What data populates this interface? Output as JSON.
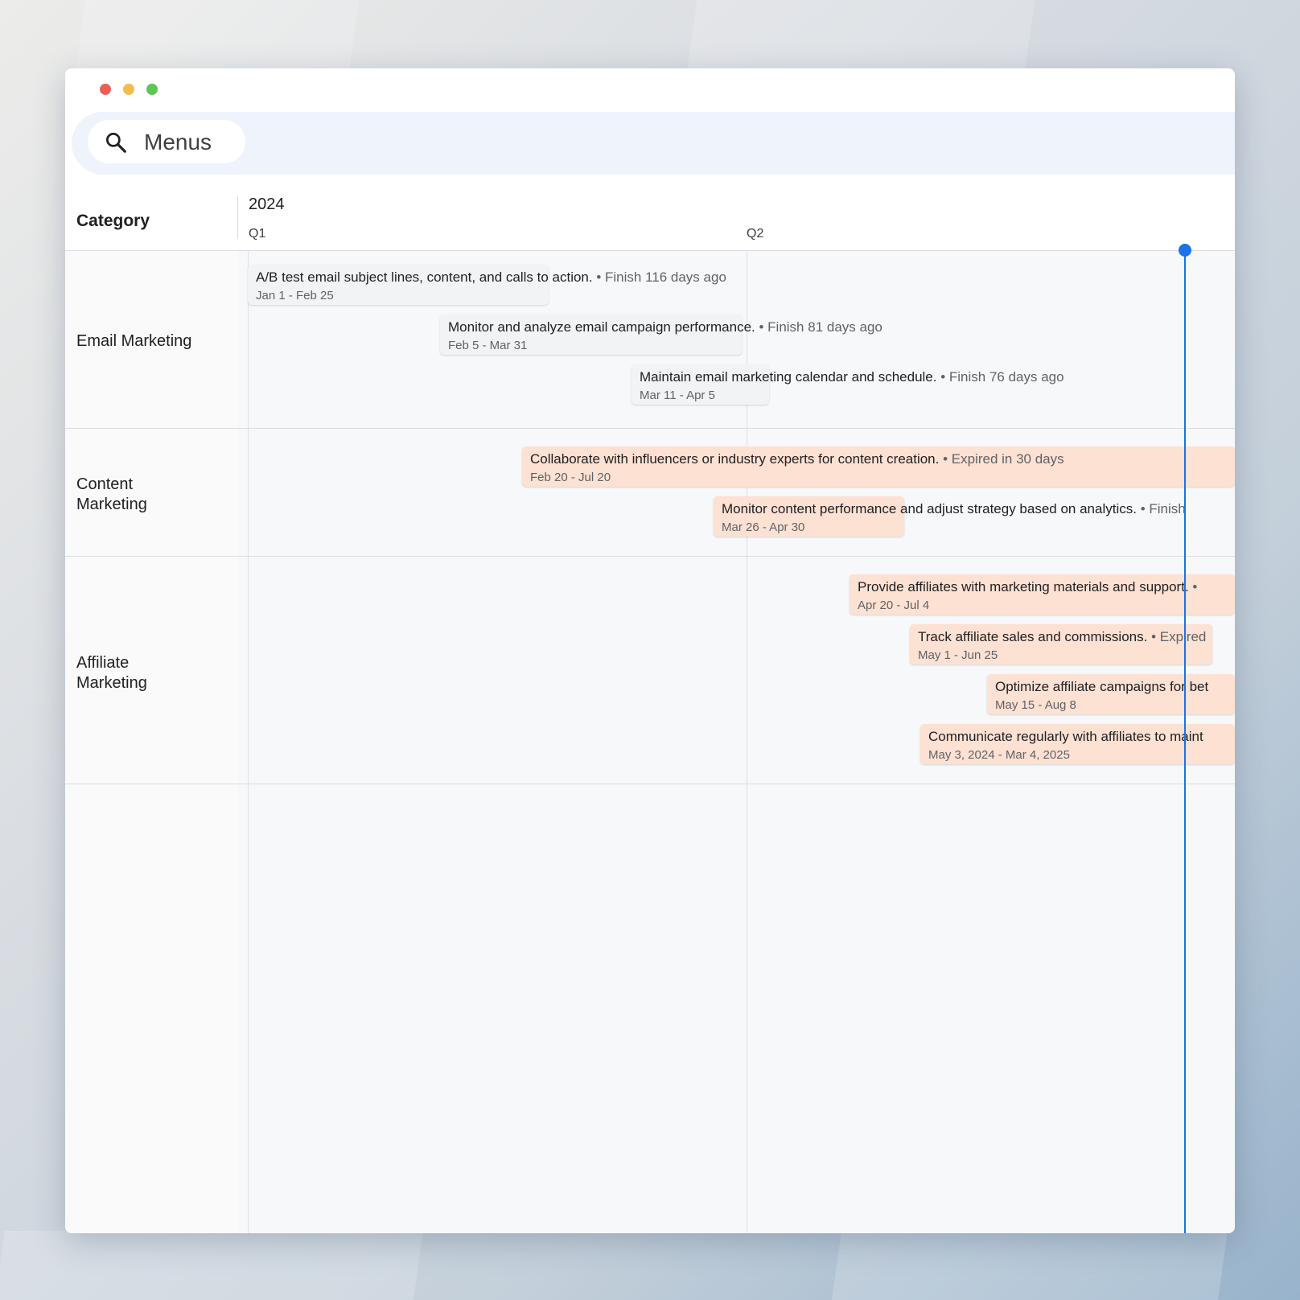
{
  "window": {
    "controls": {
      "close_color": "#ec5f57",
      "minimize_color": "#f4bd4f",
      "maximize_color": "#5fc553"
    }
  },
  "toolbar": {
    "search_icon": "search-icon",
    "search_label": "Menus"
  },
  "timeline": {
    "category_header": "Category",
    "year": "2024",
    "quarters": [
      "Q1",
      "Q2"
    ],
    "today_color": "#1a73e8",
    "categories": [
      {
        "name": "Email Marketing",
        "tasks": [
          {
            "title": "A/B test email subject lines, content, and calls to action.",
            "status": " • Finish 116 days ago",
            "dates": "Jan 1 - Feb 25",
            "style": "gray"
          },
          {
            "title": "Monitor and analyze email campaign performance.",
            "status": " • Finish 81 days ago",
            "dates": "Feb 5 - Mar 31",
            "style": "gray"
          },
          {
            "title": "Maintain email marketing calendar and schedule.",
            "status": " • Finish 76 days ago",
            "dates": "Mar 11 - Apr 5",
            "style": "gray"
          }
        ]
      },
      {
        "name": "Content Marketing",
        "tasks": [
          {
            "title": "Collaborate with influencers or industry experts for content creation.",
            "status": " • Expired in 30 days",
            "dates": "Feb 20 - Jul 20",
            "style": "peach"
          },
          {
            "title": "Monitor content performance and adjust strategy based on analytics.",
            "status": " • Finish",
            "dates": "Mar 26 - Apr 30",
            "style": "peach"
          }
        ]
      },
      {
        "name": "Affiliate Marketing",
        "tasks": [
          {
            "title": "Provide affiliates with marketing materials and support.",
            "status": " •",
            "dates": "Apr 20 - Jul 4",
            "style": "peach"
          },
          {
            "title": "Track affiliate sales and commissions.",
            "status": " • Expired",
            "dates": "May 1 - Jun 25",
            "style": "peach"
          },
          {
            "title": "Optimize affiliate campaigns for bet",
            "status": "",
            "dates": "May 15 - Aug 8",
            "style": "peach"
          },
          {
            "title": "Communicate regularly with affiliates to maint",
            "status": "",
            "dates": "May 3, 2024 - Mar 4, 2025",
            "style": "peach"
          }
        ]
      }
    ]
  }
}
